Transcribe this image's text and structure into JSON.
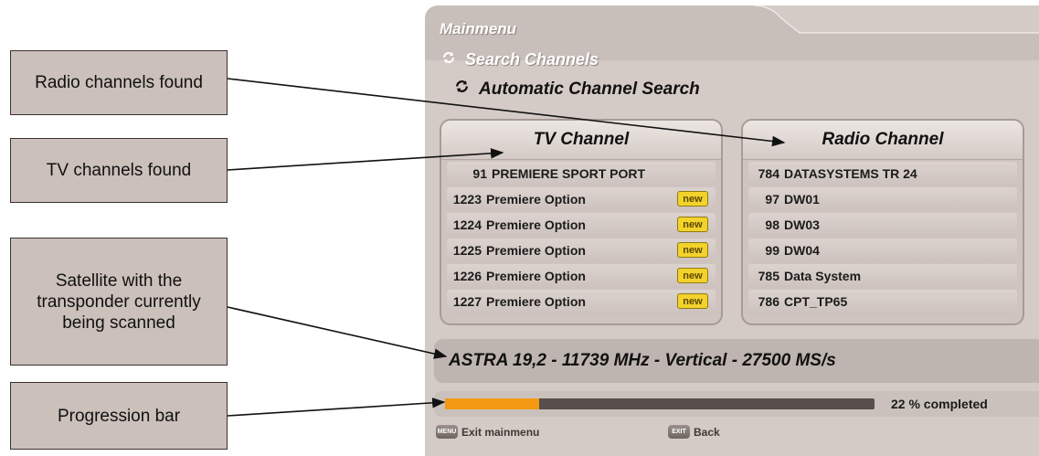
{
  "callouts": {
    "radio": "Radio channels found",
    "tv": "TV channels found",
    "satellite": "Satellite with the transponder currently being scanned",
    "progress": "Progression bar"
  },
  "header": {
    "main": "Mainmenu",
    "sub": "Search Channels",
    "current": "Automatic Channel Search",
    "icons": [
      "refresh-arrows-icon",
      "refresh-arrows-icon"
    ]
  },
  "tv": {
    "title": "TV Channel",
    "badge_label": "new",
    "rows": [
      {
        "num": "91",
        "name": "PREMIERE SPORT PORT",
        "new": false
      },
      {
        "num": "1223",
        "name": "Premiere Option",
        "new": true
      },
      {
        "num": "1224",
        "name": "Premiere Option",
        "new": true
      },
      {
        "num": "1225",
        "name": "Premiere Option",
        "new": true
      },
      {
        "num": "1226",
        "name": "Premiere Option",
        "new": true
      },
      {
        "num": "1227",
        "name": "Premiere Option",
        "new": true
      }
    ]
  },
  "radio": {
    "title": "Radio Channel",
    "rows": [
      {
        "num": "784",
        "name": "DATASYSTEMS TR 24"
      },
      {
        "num": "97",
        "name": "DW01"
      },
      {
        "num": "98",
        "name": "DW03"
      },
      {
        "num": "99",
        "name": "DW04"
      },
      {
        "num": "785",
        "name": "Data System"
      },
      {
        "num": "786",
        "name": "CPT_TP65"
      }
    ]
  },
  "satellite": "ASTRA 19,2 - 11739 MHz - Vertical - 27500 MS/s",
  "progress": {
    "value": 0.22,
    "label": "22 % completed"
  },
  "footer": {
    "exit_key": "MENU",
    "exit_label": "Exit mainmenu",
    "back_key": "EXIT",
    "back_label": "Back"
  },
  "colors": {
    "screen_bg": "#d5cbc6",
    "progress_fill": "#f39a12",
    "progress_track": "#564f4b",
    "badge": "#f3d22b",
    "callout_bg": "#cbc0ba"
  }
}
